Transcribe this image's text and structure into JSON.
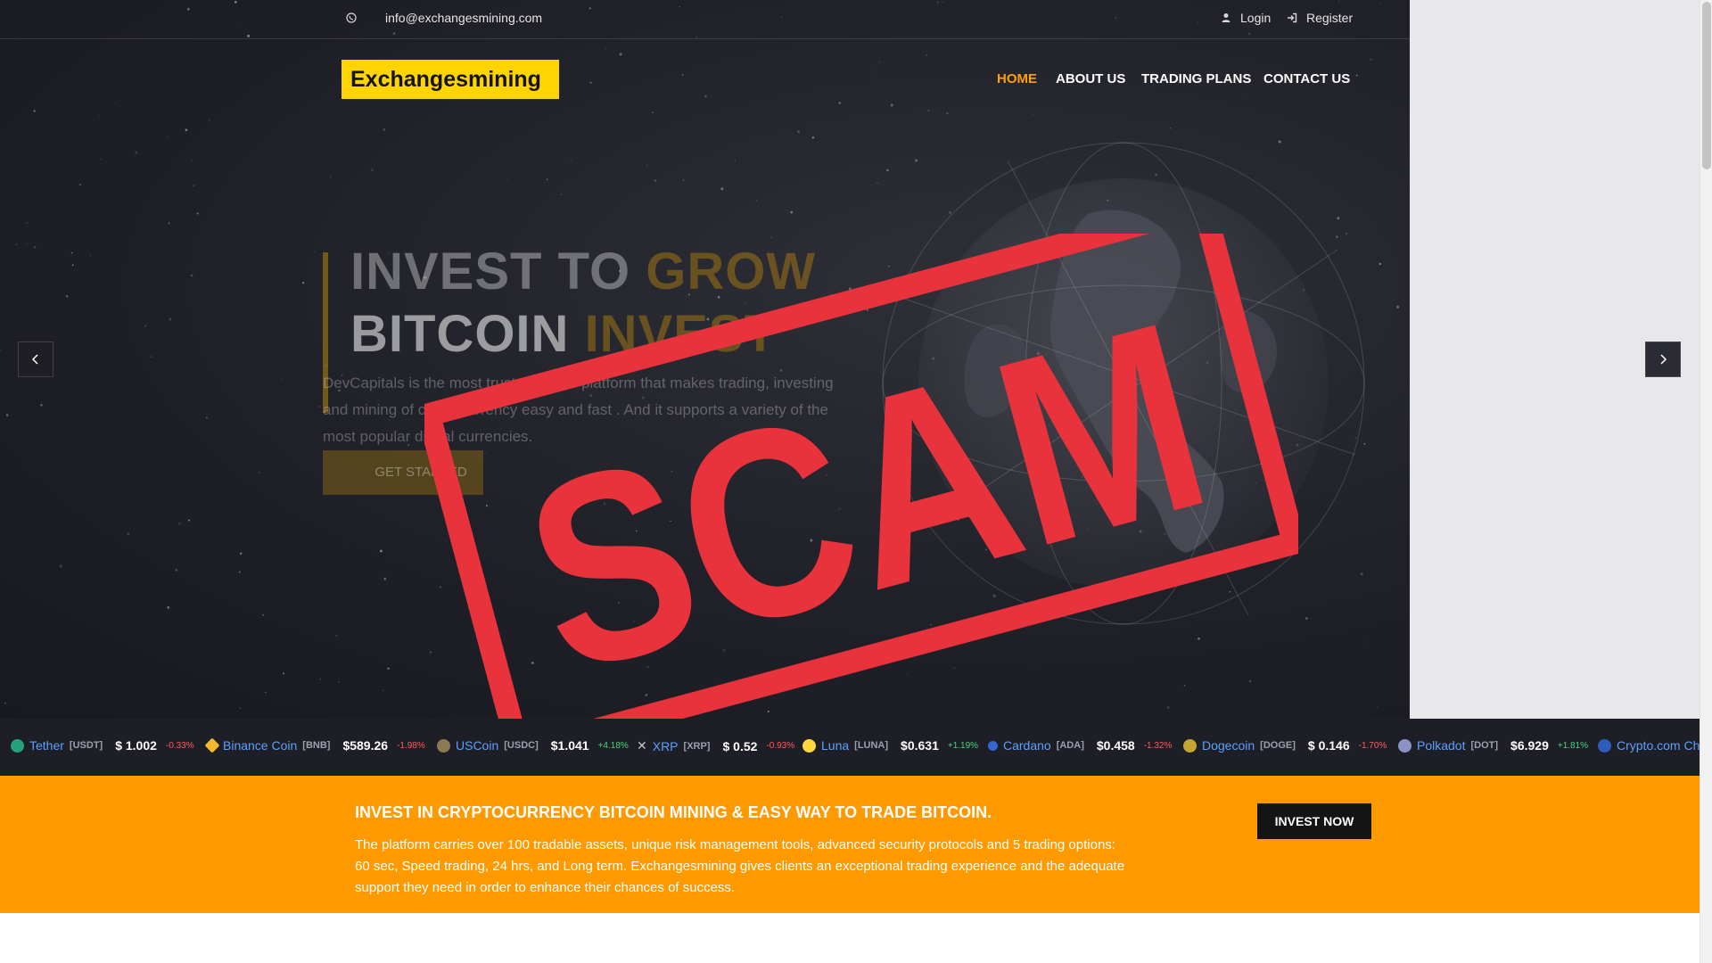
{
  "topbar": {
    "email": "info@exchangesmining.com",
    "login": "Login",
    "register": "Register"
  },
  "header": {
    "logo": "Exchangesmining",
    "nav": [
      {
        "label": "HOME",
        "active": true
      },
      {
        "label": "ABOUT US",
        "active": false
      },
      {
        "label": "TRADING PLANS",
        "active": false
      },
      {
        "label": "CONTACT US",
        "active": false
      }
    ]
  },
  "hero": {
    "headline_line1": "INVEST TO",
    "headline_line1_accent": "GROW",
    "headline_line2": "BITCOIN",
    "headline_line2_accent": "INVEST",
    "description": "DevCapitals is the most trusted online platform that makes trading, investing and mining of cryptocurrency easy and fast . And it supports a variety of the most popular digital currencies.",
    "cta": "GET STARTED",
    "stamp_text": "SCAM"
  },
  "ticker": [
    {
      "name": "Tether",
      "symbol": "[USDT]",
      "price": "$ 1.002",
      "change": "-0.33%",
      "direction": "down",
      "icon": "tether-icon",
      "color": "#26a17b"
    },
    {
      "name": "Binance Coin",
      "symbol": "[BNB]",
      "price": "$589.26",
      "change": "-1.98%",
      "direction": "down",
      "icon": "binance-icon",
      "color": "#f3ba2f"
    },
    {
      "name": "USCoin",
      "symbol": "[USDC]",
      "price": "$1.041",
      "change": "+4.18%",
      "direction": "up",
      "icon": "usdc-icon",
      "color": "#8a7a56"
    },
    {
      "name": "XRP",
      "symbol": "[XRP]",
      "price": "$ 0.52",
      "change": "-0.93%",
      "direction": "down",
      "icon": "xrp-icon",
      "color": "#bfc4cc"
    },
    {
      "name": "Luna",
      "symbol": "[LUNA]",
      "price": "$0.631",
      "change": "+1.19%",
      "direction": "up",
      "icon": "luna-icon",
      "color": "#ffd83d"
    },
    {
      "name": "Cardano",
      "symbol": "[ADA]",
      "price": "$0.458",
      "change": "-1.32%",
      "direction": "down",
      "icon": "cardano-icon",
      "color": "#3468d1"
    },
    {
      "name": "Dogecoin",
      "symbol": "[DOGE]",
      "price": "$ 0.146",
      "change": "-1.70%",
      "direction": "down",
      "icon": "dogecoin-icon",
      "color": "#c3a634"
    },
    {
      "name": "Polkadot",
      "symbol": "[DOT]",
      "price": "$6.929",
      "change": "+1.81%",
      "direction": "up",
      "icon": "polkadot-icon",
      "color": "#8a93c8"
    },
    {
      "name": "Crypto.com Ch",
      "symbol": "",
      "price": "",
      "change": "",
      "direction": "",
      "icon": "cryptocom-icon",
      "color": "#2d5db8"
    }
  ],
  "band": {
    "title": "INVEST IN CRYPTOCURRENCY BITCOIN MINING & EASY WAY TO TRADE BITCOIN.",
    "text": "The platform carries over 100 tradable assets, unique risk management tools, advanced security protocols and 5 trading options: 60 sec, Speed trading, 24 hrs, and Long term. Exchangesmining gives clients an exceptional trading experience and the adequate support they need in order to enhance their chances of success.",
    "button": "INVEST NOW"
  },
  "colors": {
    "accent": "#ff9f0a",
    "logo_bg": "#ffd400",
    "band_bg": "#ff9900",
    "stamp": "#e8323c"
  }
}
